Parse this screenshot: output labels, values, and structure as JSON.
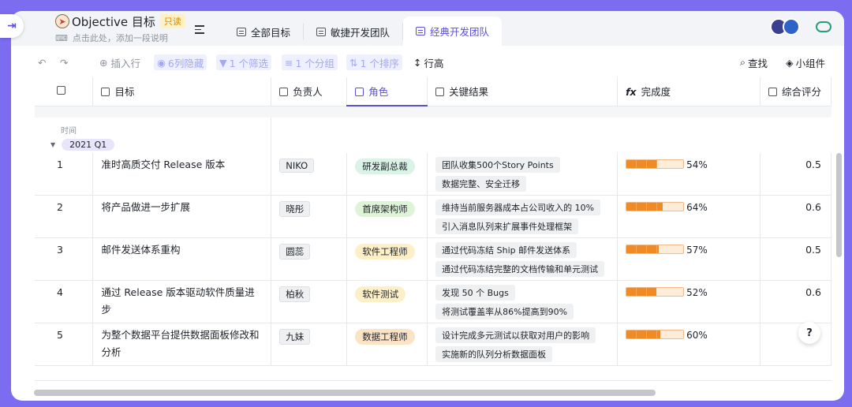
{
  "header": {
    "title": "Objective 目标",
    "readonly_badge": "只读",
    "subtitle": "点击此处，添加一段说明"
  },
  "tabs": [
    {
      "label": "全部目标"
    },
    {
      "label": "敏捷开发团队"
    },
    {
      "label": "经典开发团队"
    }
  ],
  "toolbar": {
    "insert_row": "插入行",
    "hidden_cols": "6列隐藏",
    "filter": "1 个筛选",
    "group": "1 个分组",
    "sort": "1 个排序",
    "row_height": "行高",
    "find": "查找",
    "widgets": "小组件"
  },
  "columns": {
    "goal": "目标",
    "owner": "负责人",
    "role": "角色",
    "key_results": "关键结果",
    "completion": "完成度",
    "score": "综合评分"
  },
  "group": {
    "field_label": "时间",
    "value": "2021 Q1"
  },
  "rows": [
    {
      "index": "1",
      "goal": "准时高质交付 Release 版本",
      "owner": "NIKO",
      "role": "研发副总裁",
      "role_bg": "#d9f3e6",
      "kr": [
        "团队收集500个Story Points",
        "数据完整、安全迁移"
      ],
      "progress": 0.54,
      "progress_label": "54%",
      "score": "0.5"
    },
    {
      "index": "2",
      "goal": "将产品做进一步扩展",
      "owner": "晓彤",
      "role": "首席架构师",
      "role_bg": "#dff3d8",
      "kr": [
        "维持当前服务器成本占公司收入的 10%",
        "引入消息队列来扩展事件处理框架"
      ],
      "progress": 0.64,
      "progress_label": "64%",
      "score": "0.6"
    },
    {
      "index": "3",
      "goal": "邮件发送体系重构",
      "owner": "圆蕊",
      "role": "软件工程师",
      "role_bg": "#fdf0c8",
      "kr": [
        "通过代码冻结 Ship 邮件发送体系",
        "通过代码冻结完整的文档传输和单元测试"
      ],
      "progress": 0.57,
      "progress_label": "57%",
      "score": "0.5"
    },
    {
      "index": "4",
      "goal": "通过 Release 版本驱动软件质量进步",
      "owner": "柏秋",
      "role": "软件测试",
      "role_bg": "#fdf0c8",
      "kr": [
        "发现 50 个 Bugs",
        "将测试覆盖率从86%提高到90%"
      ],
      "progress": 0.52,
      "progress_label": "52%",
      "score": "0.6"
    },
    {
      "index": "5",
      "goal": "为整个数据平台提供数据面板修改和分析",
      "owner": "九妹",
      "role": "数据工程师",
      "role_bg": "#fde3c6",
      "kr": [
        "设计完成多元测试以获取对用户的影响",
        "实施新的队列分析数据面板"
      ],
      "progress": 0.6,
      "progress_label": "60%",
      "score": ""
    }
  ],
  "help_label": "?"
}
